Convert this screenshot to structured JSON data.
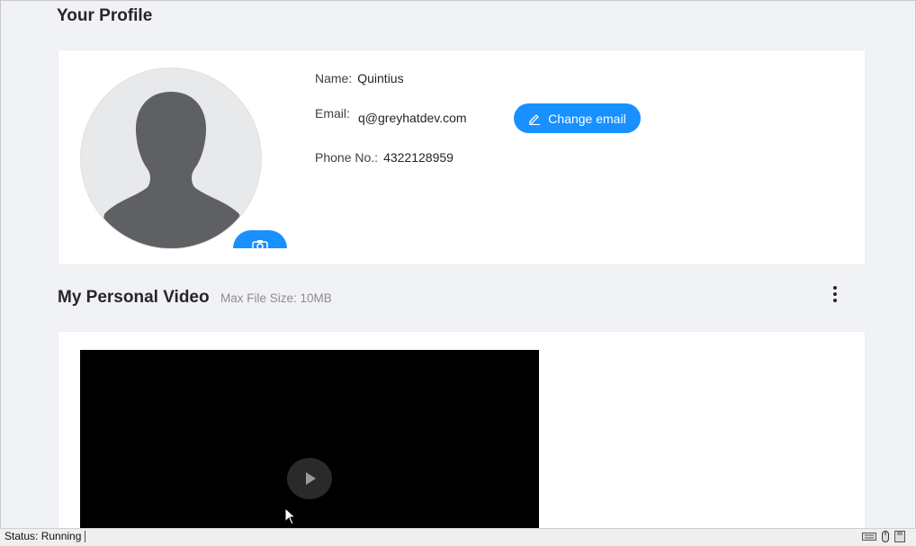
{
  "profile": {
    "title": "Your Profile",
    "name_label": "Name:",
    "name_value": "Quintius",
    "email_label": "Email:",
    "email_value": "q@greyhatdev.com",
    "change_email_label": "Change email",
    "phone_label": "Phone No.:",
    "phone_value": "4322128959"
  },
  "video": {
    "title": "My Personal Video",
    "subtitle": "Max File Size: 10MB"
  },
  "status": {
    "text": "Status: Running"
  },
  "icons": {
    "avatar": "person-silhouette-icon",
    "camera": "camera-icon",
    "edit": "edit-pencil-icon",
    "more": "more-vertical-icon",
    "play": "play-icon",
    "cursor": "mouse-pointer-icon",
    "tray": [
      "keyboard-icon",
      "mouse-icon",
      "disk-icon"
    ]
  },
  "colors": {
    "accent": "#1890ff",
    "background": "#f0f2f5",
    "card": "#ffffff",
    "video_bg": "#000000",
    "avatar_fill": "#5f6063"
  }
}
